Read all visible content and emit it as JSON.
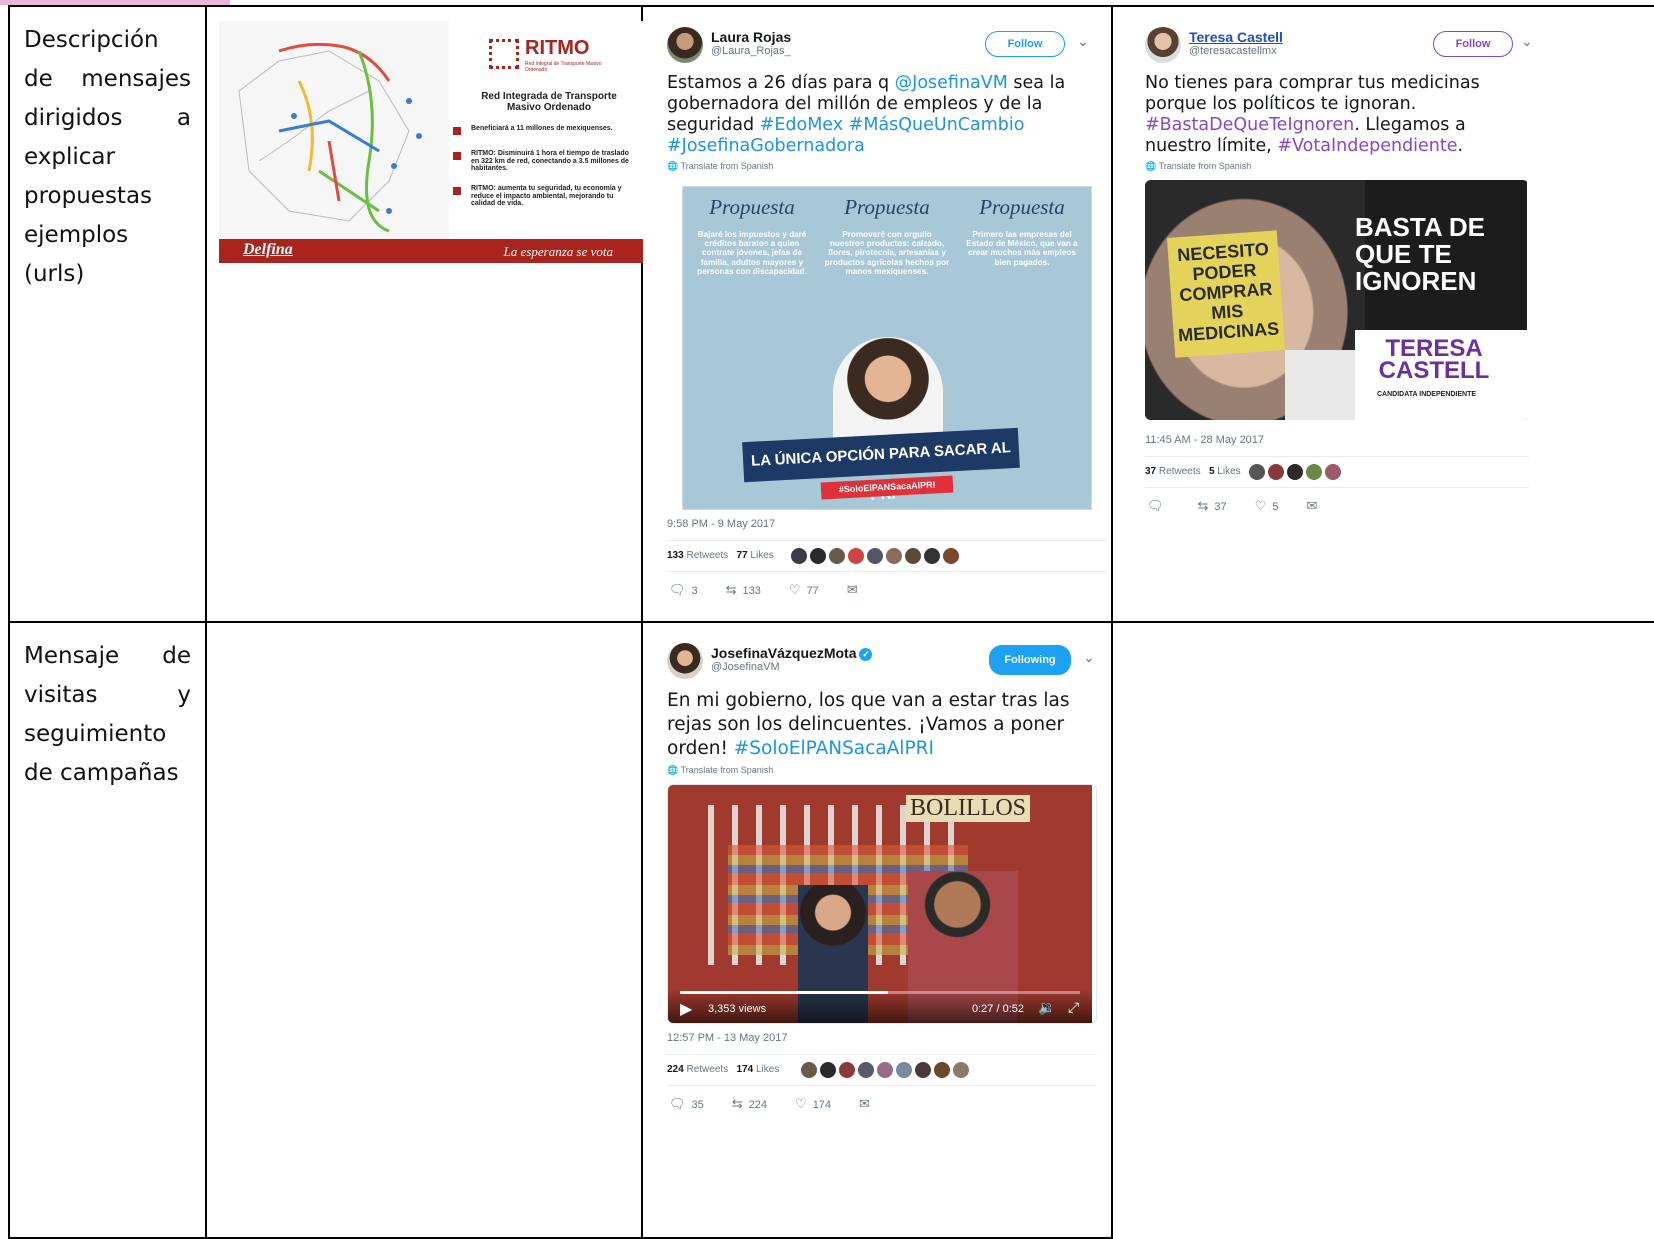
{
  "table": {
    "row1": {
      "label": "Descripción de mensajes dirigidos a explicar propuestas ejemplos (urls)"
    },
    "row2": {
      "label": "Mensaje de visitas y seguimiento de campañas"
    }
  },
  "ritmo_image": {
    "brand": "RITMO",
    "brand_sub": "Red Integral de Transporte Masivo Ordenado",
    "heading": "Red Integrada de Transporte Masivo Ordenado",
    "bullets": [
      "Beneficiará a 11 millones de mexiquenses.",
      "RITMO: Disminuirá 1 hora el tiempo de traslado en 322 km de red, conectando a 3.5 millones de habitantes.",
      "RITMO: aumenta tu seguridad, tu economía y reduce el impacto ambiental, mejorando tu calidad de vida."
    ],
    "footer_left": "Delfina",
    "footer_right": "La esperanza se vota"
  },
  "tweet_laura": {
    "name": "Laura Rojas",
    "handle": "@Laura_Rojas_",
    "follow_label": "Follow",
    "text_1": "Estamos a 26 días para q ",
    "mention": "@JosefinaVM",
    "text_2": " sea la gobernadora del millón de empleos y de la seguridad ",
    "hashtags": "#EdoMex #MásQueUnCambio #JosefinaGobernadora",
    "translate": "Translate from Spanish",
    "image": {
      "col_title": "Propuesta",
      "col1": "Bajaré los impuestos y daré créditos baratos a quien contrate jóvenes, jefas de familia, adultos mayores y personas con discapacidad.",
      "col2": "Promoveré con orgullo nuestros productos: calzado, flores, pirotecnia, artesanías y productos agrícolas hechos por manos mexiquenses.",
      "col3": "Primero las empresas del Estado de México, que van a crear muchos más empleos bien pagados.",
      "banner": "LA ÚNICA OPCIÓN PARA SACAR AL PRI",
      "banner_tag": "#SoloElPANSacaAlPRI"
    },
    "timestamp": "9:58 PM - 9 May 2017",
    "retweets": "133",
    "retweets_label": "Retweets",
    "likes": "77",
    "likes_label": "Likes",
    "replies_count": "3",
    "rt_count": "133",
    "like_count": "77"
  },
  "tweet_teresa": {
    "name": "Teresa Castell",
    "handle": "@teresacastellmx",
    "follow_label": "Follow",
    "text_1": "No tienes para comprar tus medicinas porque los políticos te ignoran. ",
    "hashtag1": "#BastaDeQueTeIgnoren",
    "text_2": ". Llegamos a nuestro límite, ",
    "hashtag2": "#VotaIndependiente",
    "text_3": ".",
    "translate": "Translate from Spanish",
    "image": {
      "note": "NECESITO PODER COMPRAR MIS MEDICINAS",
      "title": "BASTA DE QUE TE IGNOREN",
      "candidate": "TERESA CASTELL",
      "candidate_sub": "CANDIDATA INDEPENDIENTE"
    },
    "timestamp": "11:45 AM - 28 May 2017",
    "retweets": "37",
    "retweets_label": "Retweets",
    "likes": "5",
    "likes_label": "Likes",
    "rt_count": "37",
    "like_count": "5"
  },
  "tweet_josefina": {
    "name": "JosefinaVázquezMota",
    "handle": "@JosefinaVM",
    "follow_label": "Following",
    "text_1": "En mi gobierno, los que van a estar tras las rejas son los delincuentes. ¡Vamos a poner orden! ",
    "hashtag": "#SoloElPANSacaAlPRI",
    "translate": "Translate from Spanish",
    "video": {
      "sign": "BOLILLOS",
      "views": "3,353 views",
      "time": "0:27 / 0:52"
    },
    "timestamp": "12:57 PM - 13 May 2017",
    "retweets": "224",
    "retweets_label": "Retweets",
    "likes": "174",
    "likes_label": "Likes",
    "replies_count": "35",
    "rt_count": "224",
    "like_count": "174"
  },
  "colors": {
    "twitter_blue": "#1da1f2",
    "hashtag_blue": "#1b95e0",
    "hashtag_purple": "#8b46c7",
    "ritmo_red": "#a8241c"
  }
}
